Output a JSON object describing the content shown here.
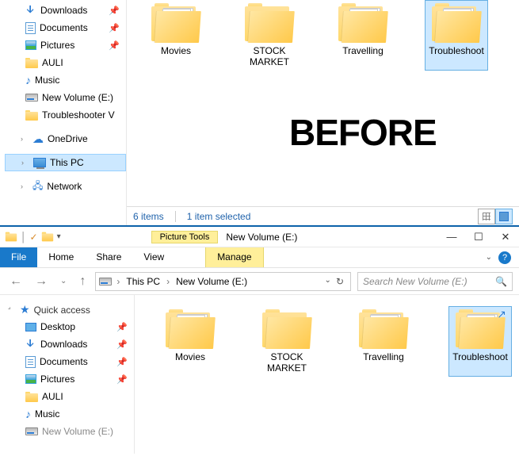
{
  "top": {
    "sidebar": {
      "downloads": "Downloads",
      "documents": "Documents",
      "pictures": "Pictures",
      "auli": "AULI",
      "music": "Music",
      "newvol": "New Volume (E:)",
      "troubleshooter": "Troubleshooter V",
      "onedrive": "OneDrive",
      "thispc": "This PC",
      "network": "Network"
    },
    "folders": [
      {
        "name": "Movies"
      },
      {
        "name": "STOCK MARKET"
      },
      {
        "name": "Travelling"
      },
      {
        "name": "Troubleshoot"
      }
    ],
    "big_label": "BEFORE",
    "status": {
      "items": "6 items",
      "selected": "1 item selected"
    }
  },
  "bottom": {
    "title": "New Volume (E:)",
    "ctx_group": "Picture Tools",
    "tabs": {
      "file": "File",
      "home": "Home",
      "share": "Share",
      "view": "View",
      "manage": "Manage"
    },
    "breadcrumb": {
      "root": "This PC",
      "leaf": "New Volume (E:)"
    },
    "search_placeholder": "Search New Volume (E:)",
    "sidebar": {
      "quick": "Quick access",
      "desktop": "Desktop",
      "downloads": "Downloads",
      "documents": "Documents",
      "pictures": "Pictures",
      "auli": "AULI",
      "music": "Music",
      "newvol": "New Volume (E:)"
    },
    "folders": [
      {
        "name": "Movies"
      },
      {
        "name": "STOCK MARKET"
      },
      {
        "name": "Travelling"
      },
      {
        "name": "Troubleshoot"
      }
    ]
  }
}
